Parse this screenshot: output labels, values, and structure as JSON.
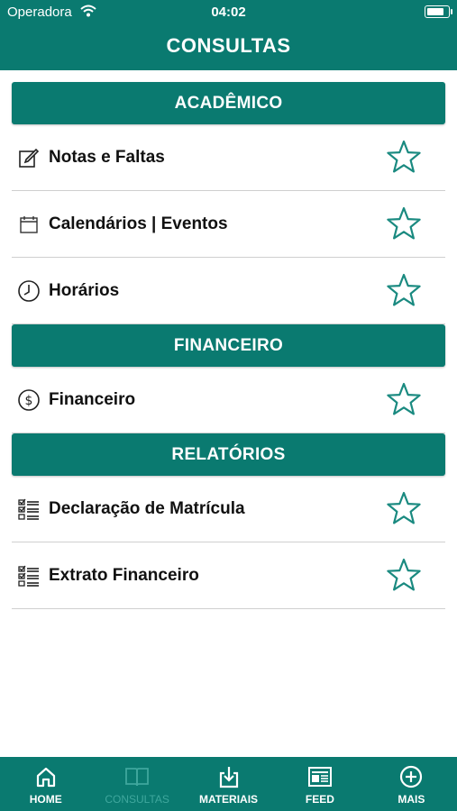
{
  "status_bar": {
    "carrier": "Operadora",
    "time": "04:02",
    "battery_level": 0.9
  },
  "header": {
    "title": "CONSULTAS"
  },
  "sections": [
    {
      "title": "ACADÊMICO",
      "items": [
        {
          "label": "Notas e Faltas",
          "icon": "edit-icon",
          "favorite": false
        },
        {
          "label": "Calendários | Eventos",
          "icon": "calendar-icon",
          "favorite": false
        },
        {
          "label": "Horários",
          "icon": "clock-icon",
          "favorite": false
        }
      ]
    },
    {
      "title": "FINANCEIRO",
      "items": [
        {
          "label": "Financeiro",
          "icon": "dollar-icon",
          "favorite": false
        }
      ]
    },
    {
      "title": "RELATÓRIOS",
      "items": [
        {
          "label": "Declaração de Matrícula",
          "icon": "checklist-icon",
          "favorite": false
        },
        {
          "label": "Extrato Financeiro",
          "icon": "checklist-icon",
          "favorite": false
        }
      ]
    }
  ],
  "tabs": [
    {
      "label": "HOME",
      "icon": "home-icon",
      "active": false
    },
    {
      "label": "CONSULTAS",
      "icon": "book-icon",
      "active": true
    },
    {
      "label": "MATERIAIS",
      "icon": "download-icon",
      "active": false
    },
    {
      "label": "FEED",
      "icon": "news-icon",
      "active": false
    },
    {
      "label": "MAIS",
      "icon": "plus-circle-icon",
      "active": false
    }
  ],
  "colors": {
    "primary": "#0a7a70",
    "tab_active": "#3fa79d",
    "star": "#1a8a80"
  }
}
